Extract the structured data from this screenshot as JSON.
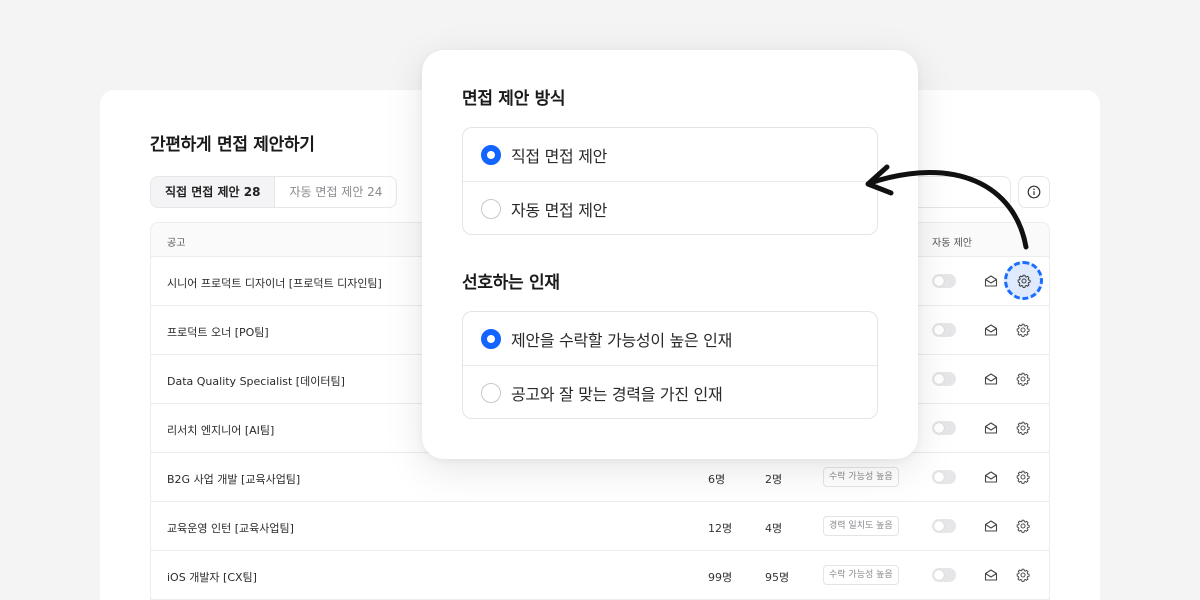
{
  "page": {
    "title": "간편하게 면접 제안하기"
  },
  "tabs": [
    {
      "label": "직접 면접 제안 28",
      "active": true
    },
    {
      "label": "자동 면접 제안 24",
      "active": false
    }
  ],
  "table": {
    "headers": {
      "job": "공고",
      "auto": "자동 제안"
    },
    "rows": [
      {
        "job": "시니어 프로덕트 디자이너 [프로덕트 디자인팀]",
        "count_a": "",
        "count_b": "",
        "chip": ""
      },
      {
        "job": "프로덕트 오너 [PO팀]",
        "count_a": "",
        "count_b": "",
        "chip": ""
      },
      {
        "job": "Data Quality Specialist [데이터팀]",
        "count_a": "",
        "count_b": "",
        "chip": ""
      },
      {
        "job": "리서치 엔지니어 [AI팀]",
        "count_a": "",
        "count_b": "",
        "chip": ""
      },
      {
        "job": "B2G 사업 개발 [교육사업팀]",
        "count_a": "6명",
        "count_b": "2명",
        "chip": "수락 가능성 높음"
      },
      {
        "job": "교육운영 인턴 [교육사업팀]",
        "count_a": "12명",
        "count_b": "4명",
        "chip": "경력 일치도 높음"
      },
      {
        "job": "iOS 개발자 [CX팀]",
        "count_a": "99명",
        "count_b": "95명",
        "chip": "수락 가능성 높음"
      }
    ]
  },
  "modal": {
    "method_title": "면접 제안 방식",
    "method_options": [
      {
        "label": "직접 면접 제안",
        "checked": true
      },
      {
        "label": "자동 면접 제안",
        "checked": false
      }
    ],
    "pref_title": "선호하는 인재",
    "pref_options": [
      {
        "label": "제안을 수락할 가능성이 높은 인재",
        "checked": true
      },
      {
        "label": "공고와 잘 맞는 경력을 가진 인재",
        "checked": false
      }
    ]
  },
  "colors": {
    "accent": "#1464ff",
    "highlight": "#1a6dff"
  },
  "icons": [
    "info-icon",
    "mail-icon",
    "gear-icon",
    "arrow-annotation"
  ]
}
